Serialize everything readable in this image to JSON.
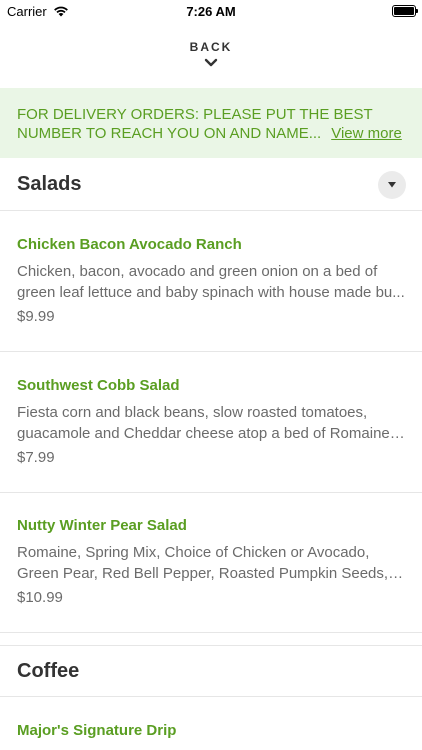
{
  "status_bar": {
    "carrier": "Carrier",
    "time": "7:26 AM"
  },
  "nav": {
    "back_label": "BACK"
  },
  "notice": {
    "line1": "FOR DELIVERY ORDERS: PLEASE PUT THE BEST",
    "line2": "NUMBER TO REACH YOU ON AND NAME...",
    "link": "View more"
  },
  "sections": [
    {
      "title": "Salads",
      "items": [
        {
          "name": "Chicken Bacon Avocado Ranch",
          "desc1": "Chicken, bacon, avocado and green onion on a bed of",
          "desc2": "green leaf lettuce and baby spinach with house made bu...",
          "price": "$9.99"
        },
        {
          "name": "Southwest Cobb Salad",
          "desc1": "Fiesta corn and black beans, slow roasted tomatoes,",
          "desc2": "guacamole and Cheddar cheese atop a bed of Romaine l...",
          "price": "$7.99"
        },
        {
          "name": "Nutty Winter Pear Salad",
          "desc1": "Romaine, Spring Mix, Choice of Chicken or Avocado,",
          "desc2": "Green Pear, Red Bell Pepper, Roasted Pumpkin Seeds, W...",
          "price": "$10.99"
        }
      ]
    },
    {
      "title": "Coffee",
      "items": [
        {
          "name": "Major's Signature Drip"
        }
      ]
    }
  ],
  "colors": {
    "accent": "#5a9e22",
    "notice_bg": "#eaf6e6",
    "text": "#333333",
    "muted": "#6b6b6b"
  }
}
